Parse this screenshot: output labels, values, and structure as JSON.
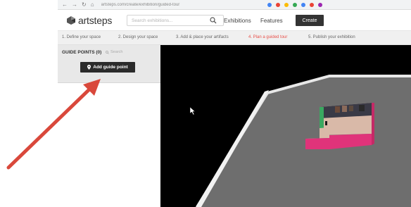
{
  "browser": {
    "url": "artsteps.com/create/exhibition/guided-tour",
    "nav_icons": [
      "back-icon",
      "forward-icon",
      "reload-icon",
      "home-icon"
    ]
  },
  "header": {
    "logo_text": "artsteps",
    "search_placeholder": "Search exhibitions...",
    "nav": {
      "exhibitions": "Exhibitions",
      "features": "Features"
    },
    "create_label": "Create"
  },
  "steps": [
    {
      "label": "1. Define your space"
    },
    {
      "label": "2. Design your space"
    },
    {
      "label": "3. Add & place your artifacts"
    },
    {
      "label": "4. Plan a guided tour"
    },
    {
      "label": "5. Publish your exhibition"
    }
  ],
  "active_step": 4,
  "sidebar": {
    "title": "GUIDE POINTS (0)",
    "search_label": "Search",
    "add_button_label": "Add guide point"
  },
  "colors": {
    "accent_active_step": "#e8504a",
    "dark_button": "#2b2b2b",
    "annotation_arrow": "#d9483b",
    "floor": "#6e6e6e",
    "room_wall": "#e0337a"
  }
}
